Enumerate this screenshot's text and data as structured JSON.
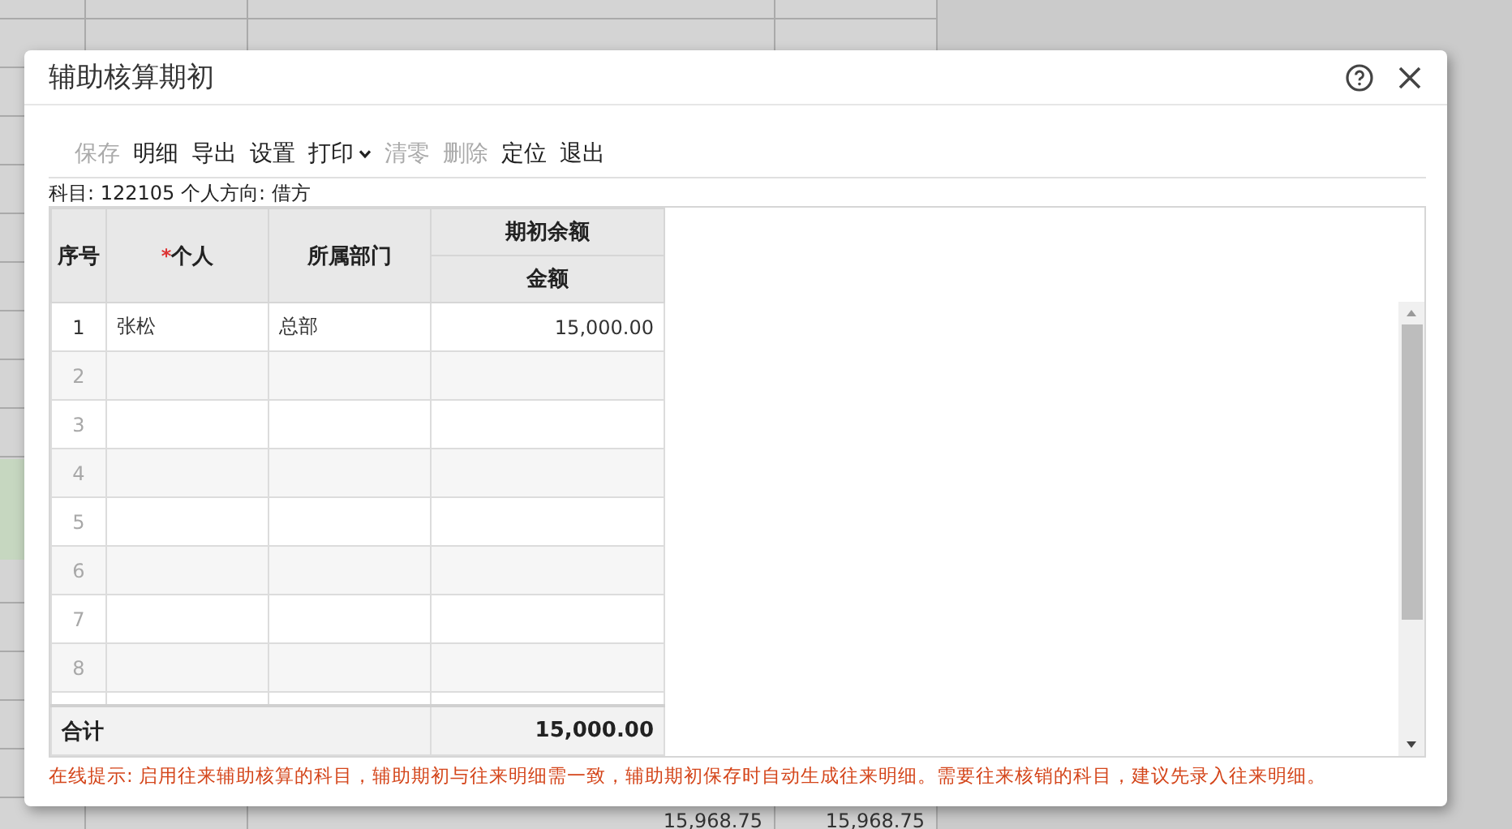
{
  "window": {
    "title": "辅助核算期初"
  },
  "toolbar": [
    {
      "label": "保存",
      "disabled": true,
      "kind": "button"
    },
    {
      "label": "明细",
      "disabled": false,
      "kind": "button"
    },
    {
      "label": "导出",
      "disabled": false,
      "kind": "button"
    },
    {
      "label": "设置",
      "disabled": false,
      "kind": "button"
    },
    {
      "label": "打印",
      "disabled": false,
      "kind": "dropdown"
    },
    {
      "label": "清零",
      "disabled": true,
      "kind": "button"
    },
    {
      "label": "删除",
      "disabled": true,
      "kind": "button"
    },
    {
      "label": "定位",
      "disabled": false,
      "kind": "button"
    },
    {
      "label": "退出",
      "disabled": false,
      "kind": "button"
    }
  ],
  "subject_line": "科目: 122105 个人方向: 借方",
  "table": {
    "required_mark": "*",
    "columns": [
      {
        "label": "序号",
        "required": false
      },
      {
        "label": "个人",
        "required": true
      },
      {
        "label": "所属部门",
        "required": false
      }
    ],
    "group_header": "期初余额",
    "amount_header": "金额",
    "rows": [
      {
        "index": "1",
        "person": "张松",
        "department": "总部",
        "amount": "15,000.00"
      },
      {
        "index": "2"
      },
      {
        "index": "3"
      },
      {
        "index": "4"
      },
      {
        "index": "5"
      },
      {
        "index": "6"
      },
      {
        "index": "7"
      },
      {
        "index": "8"
      }
    ],
    "total": {
      "label": "合计",
      "amount": "15,000.00"
    }
  },
  "tip": "在线提示: 启用往来辅助核算的科目，辅助期初与往来明细需一致，辅助期初保存时自动生成往来明细。需要往来核销的科目，建议先录入往来明细。",
  "background_cells": [
    "15,968.75",
    "15,968.75"
  ]
}
